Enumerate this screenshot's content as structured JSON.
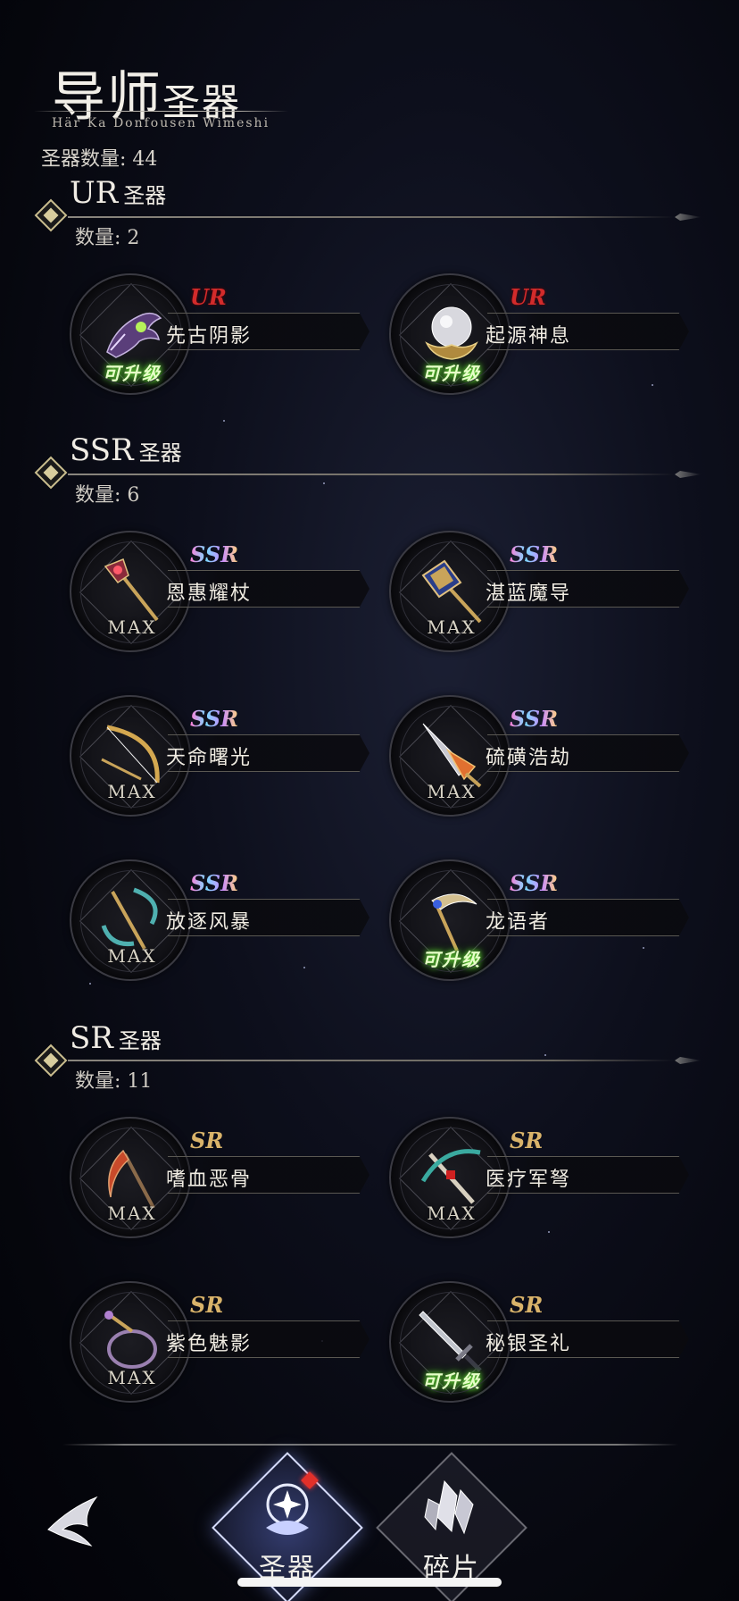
{
  "header": {
    "title_main": "导师",
    "title_small": "圣器",
    "subtitle": "Här Ka Donfousen Wimeshi",
    "total_label": "圣器数量: 44"
  },
  "sections": [
    {
      "title": "UR",
      "suffix": "圣器",
      "count_label": "数量: 2",
      "items": [
        {
          "rarity": "UR",
          "name": "先古阴影",
          "status": "可升级"
        },
        {
          "rarity": "UR",
          "name": "起源神息",
          "status": "可升级"
        }
      ]
    },
    {
      "title": "SSR",
      "suffix": "圣器",
      "count_label": "数量: 6",
      "items": [
        {
          "rarity": "SSR",
          "name": "恩惠耀杖",
          "status": "MAX"
        },
        {
          "rarity": "SSR",
          "name": "湛蓝魔导",
          "status": "MAX"
        },
        {
          "rarity": "SSR",
          "name": "天命曙光",
          "status": "MAX"
        },
        {
          "rarity": "SSR",
          "name": "硫磺浩劫",
          "status": "MAX"
        },
        {
          "rarity": "SSR",
          "name": "放逐风暴",
          "status": "MAX"
        },
        {
          "rarity": "SSR",
          "name": "龙语者",
          "status": "可升级"
        }
      ]
    },
    {
      "title": "SR",
      "suffix": "圣器",
      "count_label": "数量: 11",
      "items": [
        {
          "rarity": "SR",
          "name": "嗜血恶骨",
          "status": "MAX"
        },
        {
          "rarity": "SR",
          "name": "医疗军弩",
          "status": "MAX"
        },
        {
          "rarity": "SR",
          "name": "紫色魅影",
          "status": "MAX"
        },
        {
          "rarity": "SR",
          "name": "秘银圣礼",
          "status": "可升级"
        }
      ]
    }
  ],
  "nav": {
    "tabs": [
      {
        "label": "圣器",
        "icon": "artifact-emblem-icon",
        "active": true
      },
      {
        "label": "碎片",
        "icon": "shard-crystal-icon",
        "active": false
      }
    ],
    "back_icon": "winged-back-icon"
  },
  "colors": {
    "ur": "#d22b2b",
    "sr": "#d9b36a",
    "upgrade_glow": "#6fe23c"
  }
}
